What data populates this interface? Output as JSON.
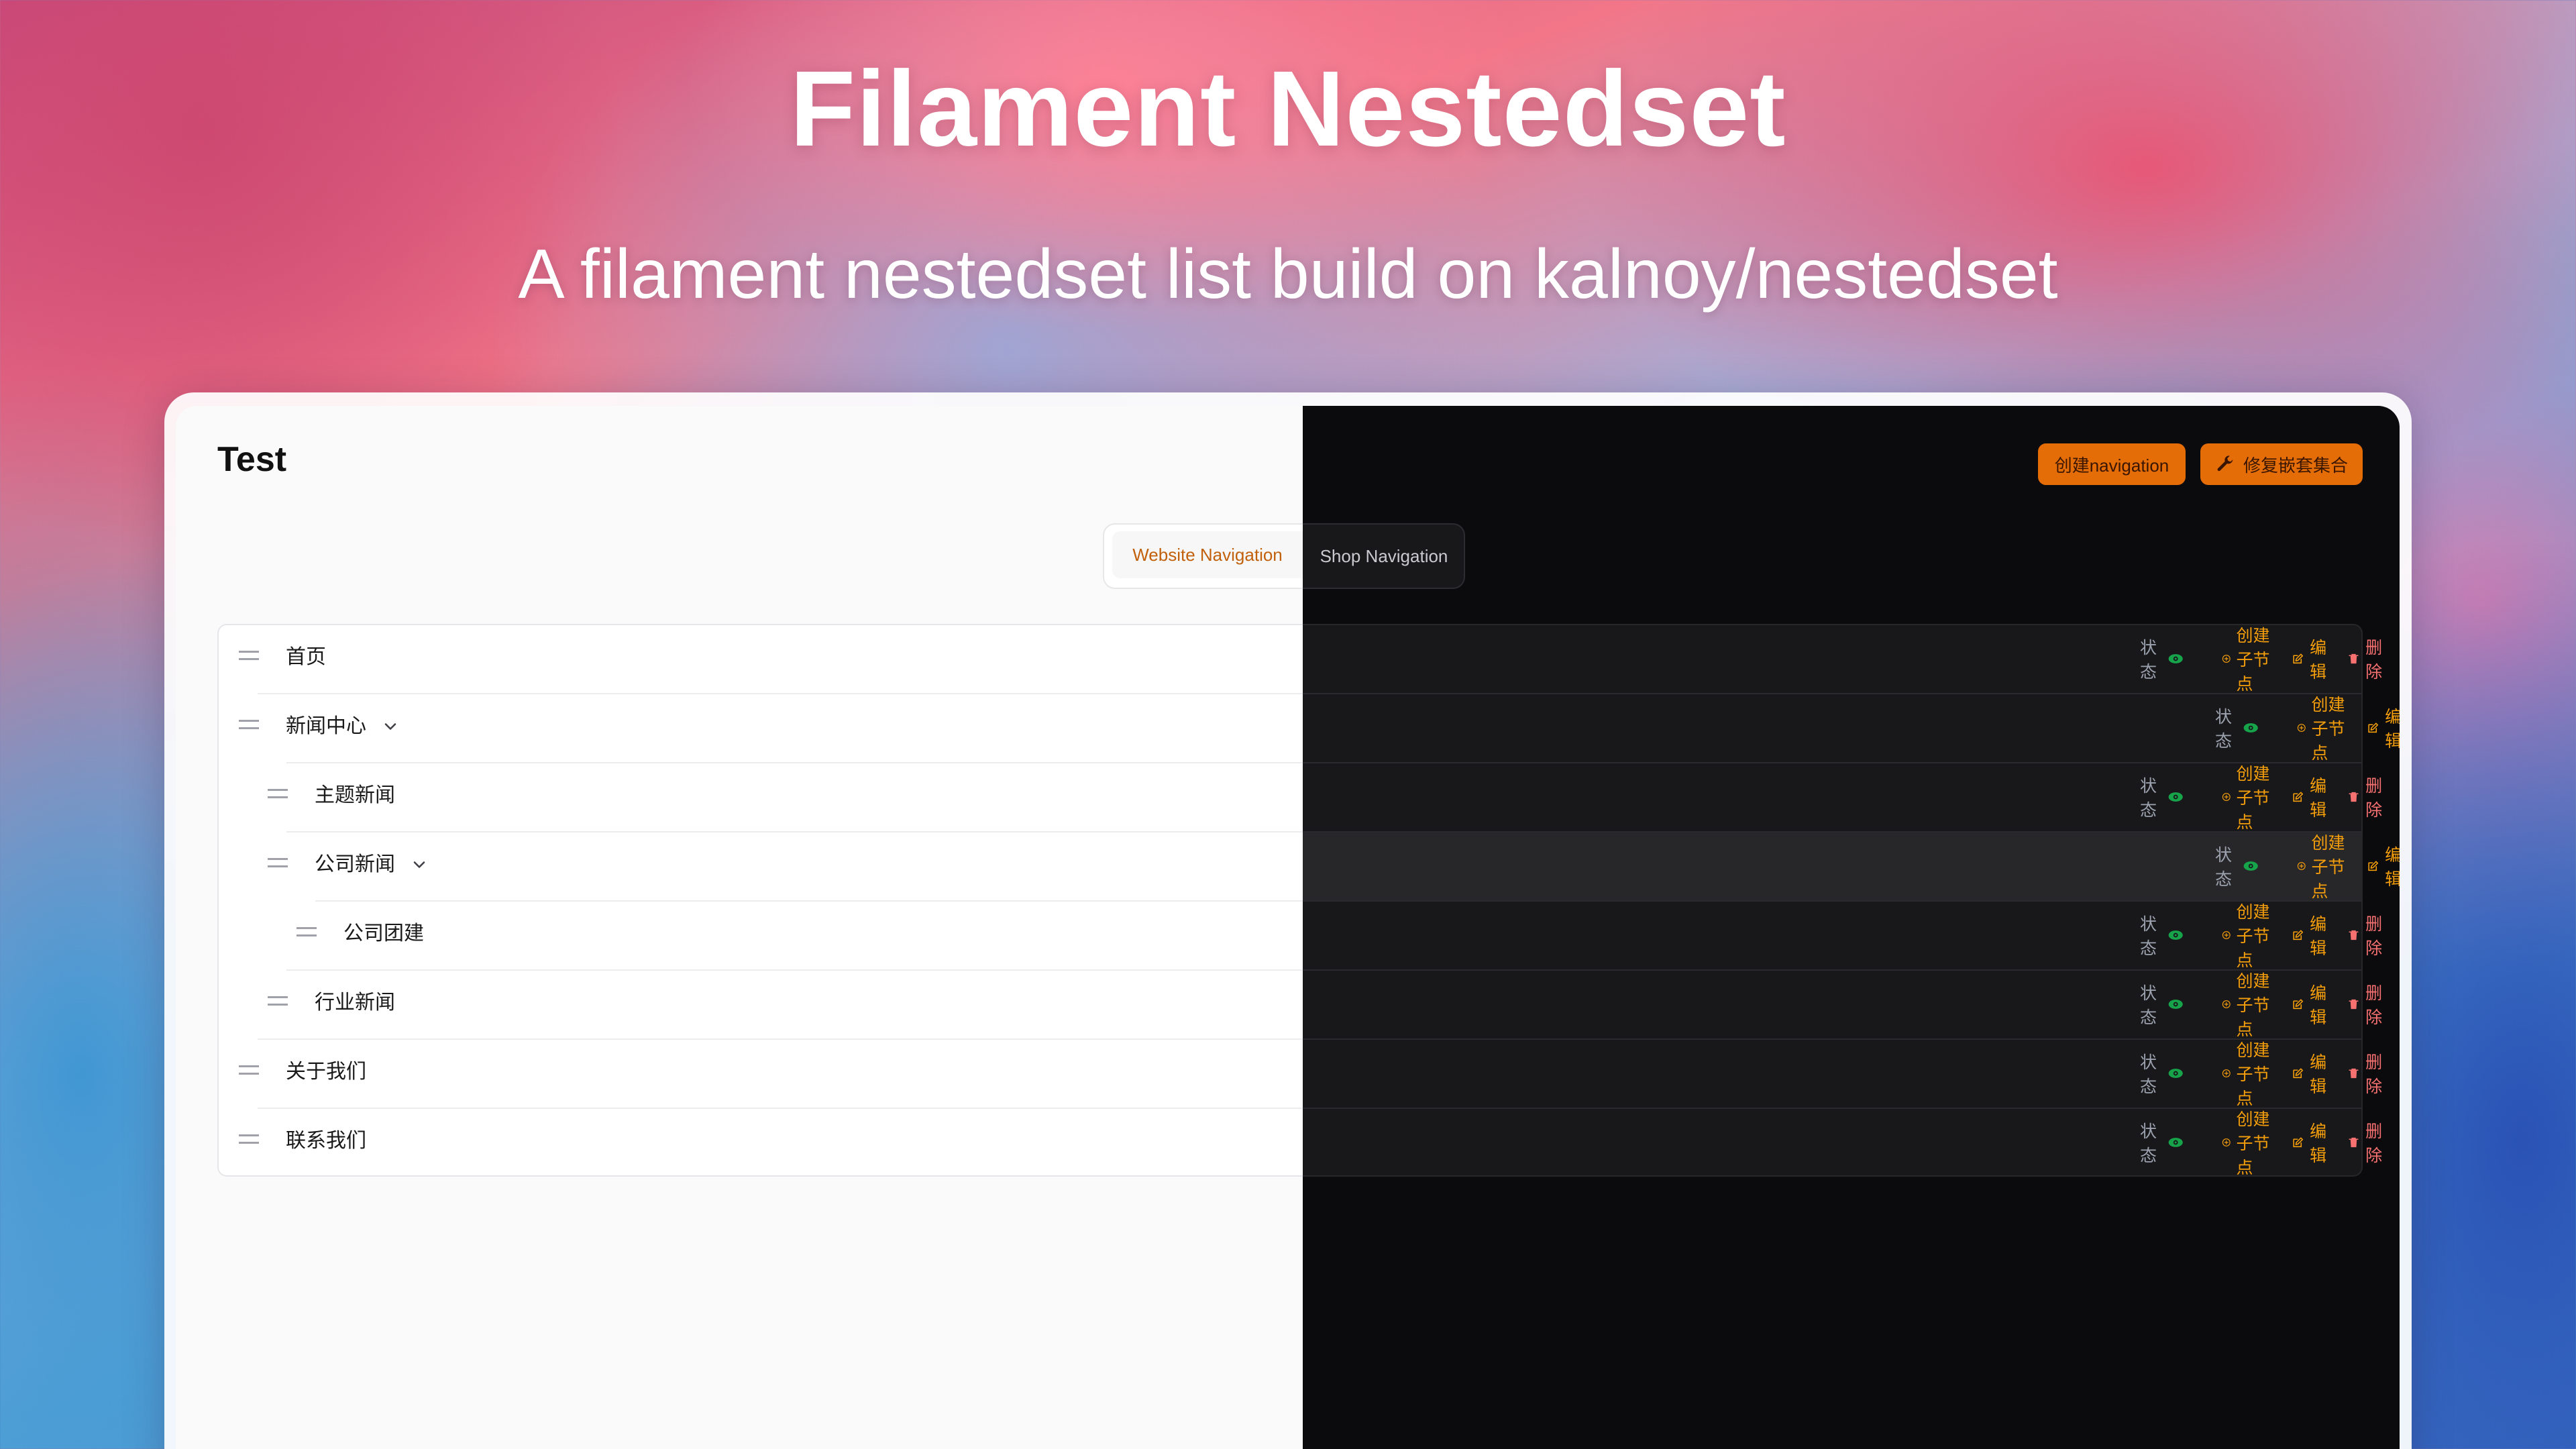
{
  "hero": {
    "title": "Filament Nestedset",
    "subtitle": "A filament nestedset list build on kalnoy/nestedset"
  },
  "page": {
    "title": "Test"
  },
  "header_actions": {
    "create_label": "创建navigation",
    "fix_label": "修复嵌套集合",
    "accent_color": "#e56d07"
  },
  "tabs": [
    {
      "label": "Website Navigation",
      "active": true
    },
    {
      "label": "Shop Navigation",
      "active": false
    }
  ],
  "row_actions": {
    "status_label": "状态",
    "create_child_label": "创建子节点",
    "edit_label": "编辑",
    "delete_label": "删除",
    "status_color": "#16a34a"
  },
  "tree": [
    {
      "label": "首页",
      "depth": 0,
      "expandable": false,
      "deletable": true
    },
    {
      "label": "新闻中心",
      "depth": 0,
      "expandable": true,
      "deletable": false
    },
    {
      "label": "主题新闻",
      "depth": 1,
      "expandable": false,
      "deletable": true
    },
    {
      "label": "公司新闻",
      "depth": 1,
      "expandable": true,
      "deletable": false,
      "highlighted": true
    },
    {
      "label": "公司团建",
      "depth": 2,
      "expandable": false,
      "deletable": true
    },
    {
      "label": "行业新闻",
      "depth": 1,
      "expandable": false,
      "deletable": true
    },
    {
      "label": "关于我们",
      "depth": 0,
      "expandable": false,
      "deletable": true
    },
    {
      "label": "联系我们",
      "depth": 0,
      "expandable": false,
      "deletable": true
    }
  ]
}
